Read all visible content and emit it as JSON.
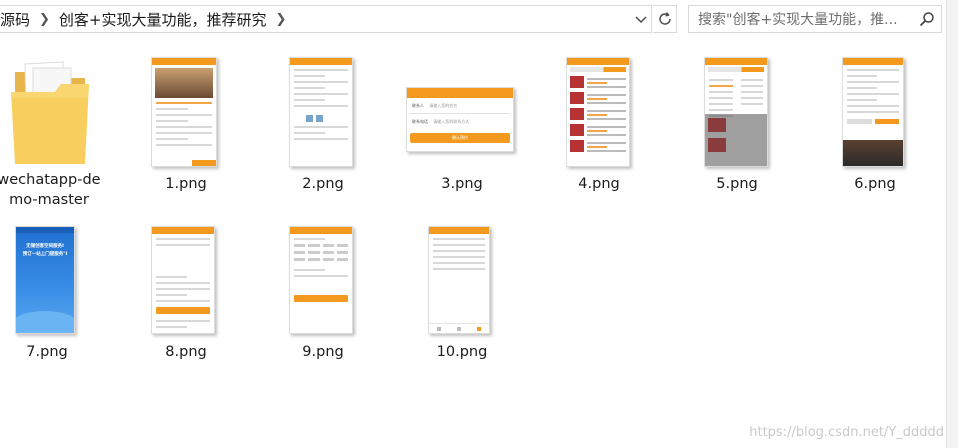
{
  "address_bar": {
    "segments": [
      "源码",
      "创客+实现大量功能，推荐研究"
    ],
    "search_placeholder": "搜索\"创客+实现大量功能，推..."
  },
  "files": [
    {
      "name": "wechatapp-de\nmo-master",
      "name_line1": "wechatapp-de",
      "name_line2": "mo-master",
      "type": "folder"
    },
    {
      "name": "1.png",
      "type": "image"
    },
    {
      "name": "2.png",
      "type": "image"
    },
    {
      "name": "3.png",
      "type": "image"
    },
    {
      "name": "4.png",
      "type": "image"
    },
    {
      "name": "5.png",
      "type": "image"
    },
    {
      "name": "6.png",
      "type": "image"
    },
    {
      "name": "7.png",
      "type": "image"
    },
    {
      "name": "8.png",
      "type": "image"
    },
    {
      "name": "9.png",
      "type": "image"
    },
    {
      "name": "10.png",
      "type": "image"
    }
  ],
  "thumb3": {
    "label1": "联系人",
    "ph1": "请输入您的姓名",
    "label2": "联系电话",
    "ph2": "请输入您的联系方式",
    "button": "确认预约"
  },
  "thumb7": {
    "line1": "无锡创客空间服务I",
    "line2": "预订一站上门提服务\"I"
  },
  "watermark": "https://blog.csdn.net/Y_ddddd",
  "colors": {
    "accent": "#f39a1e",
    "folder": "#f8cf5e",
    "app_blue": "#2d7fd8"
  }
}
